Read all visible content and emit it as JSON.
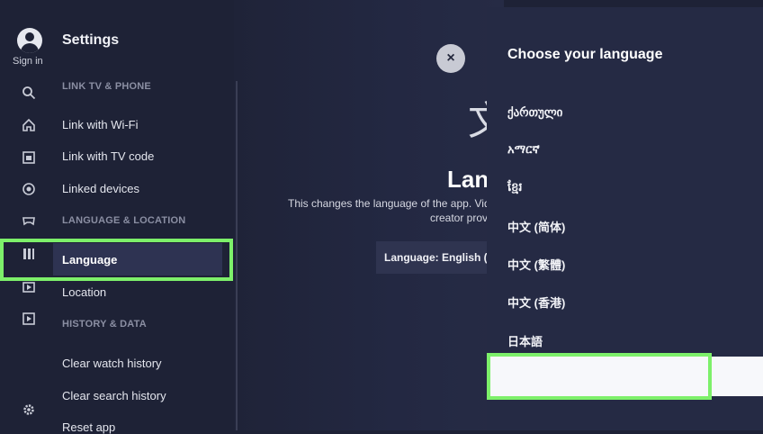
{
  "user": {
    "sign_in_label": "Sign in"
  },
  "rail": {
    "icons": [
      "search-icon",
      "home-icon",
      "subscriptions-icon",
      "library-icon",
      "gaming-icon",
      "language-icon",
      "video-icon",
      "playlist-icon",
      "gear-icon"
    ]
  },
  "settings": {
    "title": "Settings",
    "sections": {
      "link": "LINK TV & PHONE",
      "language": "LANGUAGE & LOCATION",
      "history": "HISTORY & DATA"
    },
    "items": {
      "link_wifi": "Link with Wi-Fi",
      "link_tv_code": "Link with TV code",
      "linked_devices": "Linked devices",
      "language": "Language",
      "location": "Location",
      "clear_watch": "Clear watch history",
      "clear_search": "Clear search history",
      "reset_app": "Reset app"
    }
  },
  "detail": {
    "close_icon": "×",
    "glyph": "文",
    "title": "Lan",
    "description_line1": "This changes the language of the app. Vid",
    "description_line2": "creator prov",
    "language_button": "Language: English (US"
  },
  "language_panel": {
    "title": "Choose your language",
    "options": [
      "ქართული",
      "አማርኛ",
      "ខ្មែរ",
      "中文 (简体)",
      "中文 (繁體)",
      "中文 (香港)",
      "日本語"
    ]
  },
  "colors": {
    "background": "#1e2236",
    "panel": "#252a44",
    "highlight": "#7df06a",
    "selected_item": "#2e3352"
  }
}
